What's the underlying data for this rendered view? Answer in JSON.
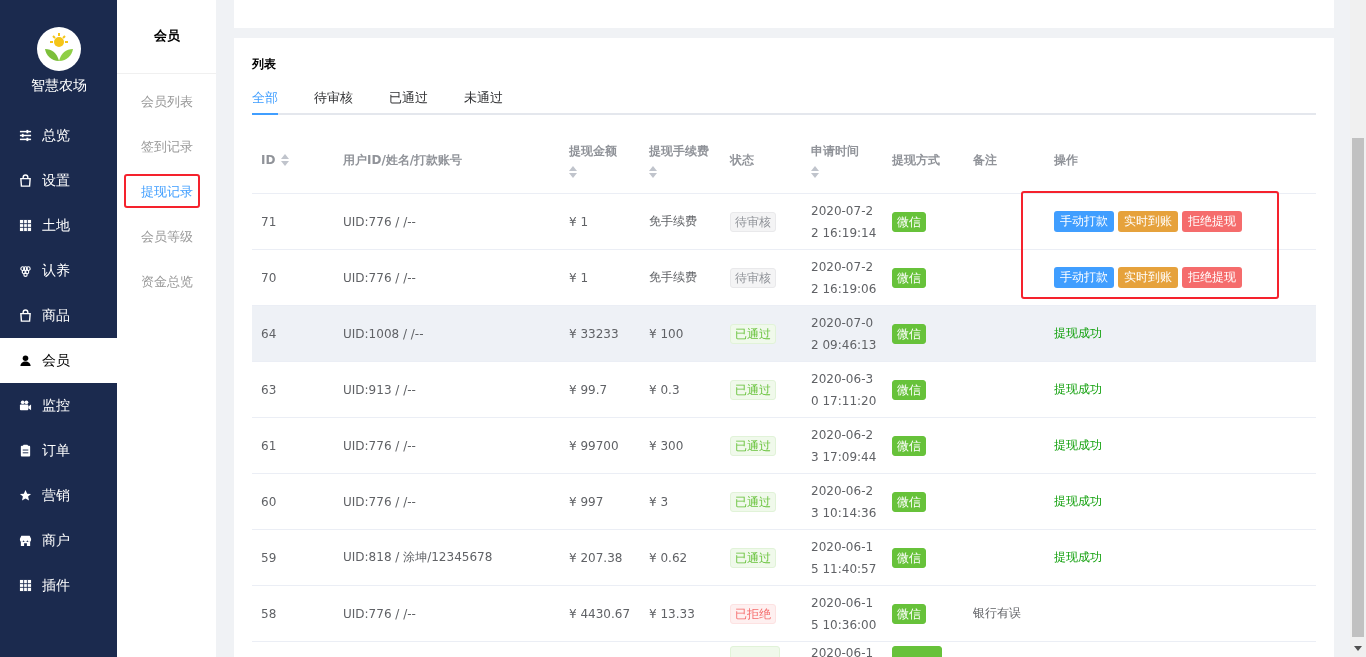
{
  "brand": {
    "name": "智慧农场"
  },
  "nav": [
    {
      "label": "总览",
      "selected": false
    },
    {
      "label": "设置",
      "selected": false
    },
    {
      "label": "土地",
      "selected": false
    },
    {
      "label": "认养",
      "selected": false
    },
    {
      "label": "商品",
      "selected": false
    },
    {
      "label": "会员",
      "selected": true
    },
    {
      "label": "监控",
      "selected": false
    },
    {
      "label": "订单",
      "selected": false
    },
    {
      "label": "营销",
      "selected": false
    },
    {
      "label": "商户",
      "selected": false
    },
    {
      "label": "插件",
      "selected": false
    }
  ],
  "submenu": {
    "title": "会员",
    "items": [
      {
        "label": "会员列表",
        "selected": false,
        "highlighted": false
      },
      {
        "label": "签到记录",
        "selected": false,
        "highlighted": false
      },
      {
        "label": "提现记录",
        "selected": true,
        "highlighted": true
      },
      {
        "label": "会员等级",
        "selected": false,
        "highlighted": false
      },
      {
        "label": "资金总览",
        "selected": false,
        "highlighted": false
      }
    ]
  },
  "list": {
    "title": "列表",
    "tabs": [
      {
        "label": "全部",
        "selected": true
      },
      {
        "label": "待审核",
        "selected": false
      },
      {
        "label": "已通过",
        "selected": false
      },
      {
        "label": "未通过",
        "selected": false
      }
    ],
    "columns": [
      {
        "label": "ID",
        "sortable": true
      },
      {
        "label": "用户ID/姓名/打款账号",
        "sortable": false
      },
      {
        "label": "提现金额",
        "sortable": true
      },
      {
        "label": "提现手续费",
        "sortable": true
      },
      {
        "label": "状态",
        "sortable": false
      },
      {
        "label": "申请时间",
        "sortable": true
      },
      {
        "label": "提现方式",
        "sortable": false
      },
      {
        "label": "备注",
        "sortable": false
      },
      {
        "label": "操作",
        "sortable": false
      }
    ],
    "actions_highlighted": true,
    "rows": [
      {
        "id": "71",
        "user": "UID:776 / /--",
        "amount": "¥ 1",
        "fee": "免手续费",
        "status": {
          "kind": "pending",
          "text": "待审核"
        },
        "time": [
          "2020-07-2",
          "2 16:19:14"
        ],
        "method": "微信",
        "note": null,
        "actions": [
          {
            "kind": "primary",
            "label": "手动打款"
          },
          {
            "kind": "warning",
            "label": "实时到账"
          },
          {
            "kind": "danger",
            "label": "拒绝提现"
          }
        ],
        "result": null,
        "hover": false
      },
      {
        "id": "70",
        "user": "UID:776 / /--",
        "amount": "¥ 1",
        "fee": "免手续费",
        "status": {
          "kind": "pending",
          "text": "待审核"
        },
        "time": [
          "2020-07-2",
          "2 16:19:06"
        ],
        "method": "微信",
        "note": null,
        "actions": [
          {
            "kind": "primary",
            "label": "手动打款"
          },
          {
            "kind": "warning",
            "label": "实时到账"
          },
          {
            "kind": "danger",
            "label": "拒绝提现"
          }
        ],
        "result": null,
        "hover": false
      },
      {
        "id": "64",
        "user": "UID:1008 / /--",
        "amount": "¥ 33233",
        "fee": "¥ 100",
        "status": {
          "kind": "passed",
          "text": "已通过"
        },
        "time": [
          "2020-07-0",
          "2 09:46:13"
        ],
        "method": "微信",
        "note": null,
        "actions": [],
        "result": "提现成功",
        "hover": true
      },
      {
        "id": "63",
        "user": "UID:913 / /--",
        "amount": "¥ 99.7",
        "fee": "¥ 0.3",
        "status": {
          "kind": "passed",
          "text": "已通过"
        },
        "time": [
          "2020-06-3",
          "0 17:11:20"
        ],
        "method": "微信",
        "note": null,
        "actions": [],
        "result": "提现成功",
        "hover": false
      },
      {
        "id": "61",
        "user": "UID:776 / /--",
        "amount": "¥ 99700",
        "fee": "¥ 300",
        "status": {
          "kind": "passed",
          "text": "已通过"
        },
        "time": [
          "2020-06-2",
          "3 17:09:44"
        ],
        "method": "微信",
        "note": null,
        "actions": [],
        "result": "提现成功",
        "hover": false
      },
      {
        "id": "60",
        "user": "UID:776 / /--",
        "amount": "¥ 997",
        "fee": "¥ 3",
        "status": {
          "kind": "passed",
          "text": "已通过"
        },
        "time": [
          "2020-06-2",
          "3 10:14:36"
        ],
        "method": "微信",
        "note": null,
        "actions": [],
        "result": "提现成功",
        "hover": false
      },
      {
        "id": "59",
        "user": "UID:818 / 涂坤/12345678",
        "amount": "¥ 207.38",
        "fee": "¥ 0.62",
        "status": {
          "kind": "passed",
          "text": "已通过"
        },
        "time": [
          "2020-06-1",
          "5 11:40:57"
        ],
        "method": "微信",
        "note": null,
        "actions": [],
        "result": "提现成功",
        "hover": false
      },
      {
        "id": "58",
        "user": "UID:776 / /--",
        "amount": "¥ 4430.67",
        "fee": "¥ 13.33",
        "status": {
          "kind": "rejected",
          "text": "已拒绝"
        },
        "time": [
          "2020-06-1",
          "5 10:36:00"
        ],
        "method": "微信",
        "note": "银行有误",
        "actions": [],
        "result": null,
        "hover": false
      }
    ],
    "partial_row": {
      "time": "2020-06-1"
    }
  }
}
